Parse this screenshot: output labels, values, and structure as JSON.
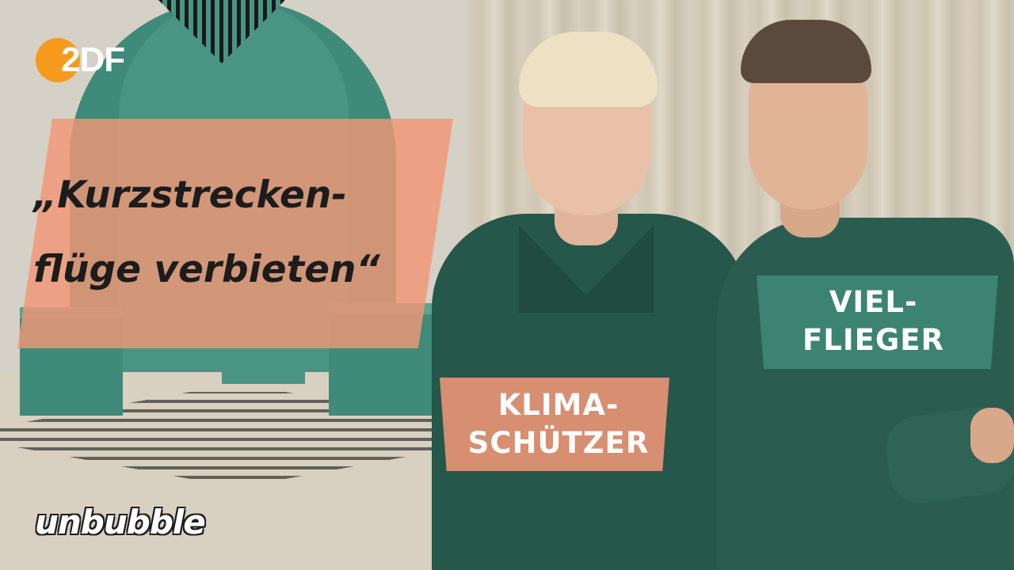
{
  "logo": {
    "text": "2DF",
    "icon": "zdf-logo-icon",
    "color": "#f59a1c"
  },
  "headline": {
    "text": "„Kurzstrecken-\nflüge verbieten“"
  },
  "labels": {
    "left": "KLIMA-\nSCHÜTZER",
    "right": "VIEL-\nFLIEGER"
  },
  "brand": {
    "text": "unbubble"
  },
  "colors": {
    "accent_orange": "#f0967a",
    "accent_green": "#3f8a78"
  }
}
